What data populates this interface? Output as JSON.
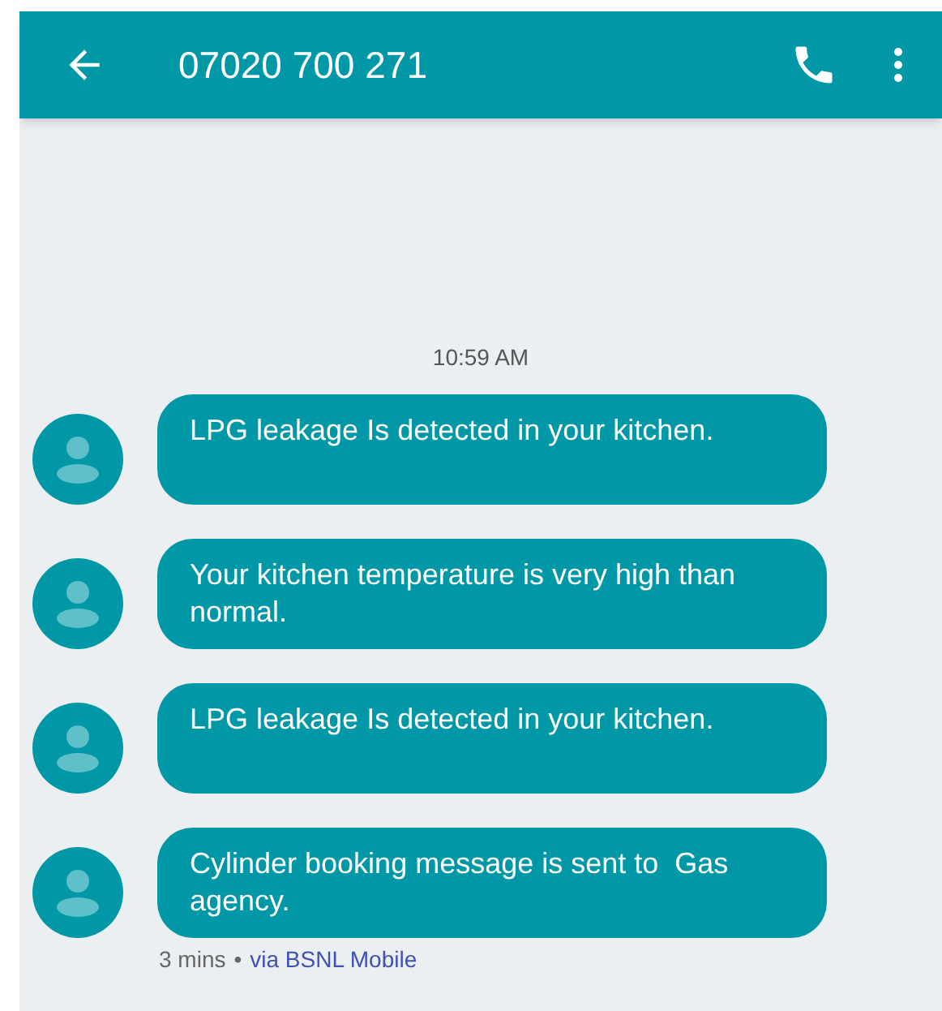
{
  "header": {
    "title": "07020 700 271"
  },
  "timestamp": "10:59 AM",
  "messages": [
    {
      "text": "LPG leakage Is detected in your kitchen."
    },
    {
      "text": "Your kitchen temperature is very high than normal."
    },
    {
      "text": "LPG leakage Is detected in your kitchen."
    },
    {
      "text": "Cylinder booking message is sent to  Gas agency."
    }
  ],
  "meta": {
    "age": "3 mins",
    "separator": "•",
    "via": "via BSNL Mobile"
  }
}
